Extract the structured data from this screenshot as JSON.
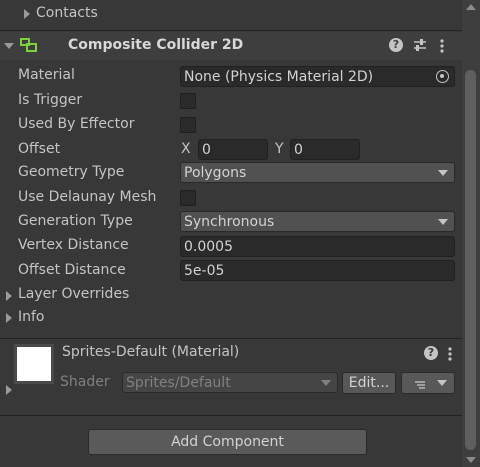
{
  "contacts": {
    "label": "Contacts"
  },
  "component": {
    "title": "Composite Collider 2D",
    "material": {
      "label": "Material",
      "value": "None (Physics Material 2D)"
    },
    "is_trigger": {
      "label": "Is Trigger"
    },
    "used_by_effector": {
      "label": "Used By Effector"
    },
    "offset": {
      "label": "Offset",
      "x_label": "X",
      "x_value": "0",
      "y_label": "Y",
      "y_value": "0"
    },
    "geometry_type": {
      "label": "Geometry Type",
      "value": "Polygons"
    },
    "use_delaunay_mesh": {
      "label": "Use Delaunay Mesh"
    },
    "generation_type": {
      "label": "Generation Type",
      "value": "Synchronous"
    },
    "vertex_distance": {
      "label": "Vertex Distance",
      "value": "0.0005"
    },
    "offset_distance": {
      "label": "Offset Distance",
      "value": "5e-05"
    },
    "layer_overrides": {
      "label": "Layer Overrides"
    },
    "info": {
      "label": "Info"
    }
  },
  "material_section": {
    "title": "Sprites-Default (Material)",
    "shader_label": "Shader",
    "shader_value": "Sprites/Default",
    "edit_label": "Edit..."
  },
  "add_component": {
    "label": "Add Component"
  },
  "colors": {
    "background": "#383838",
    "field": "#2a2a2a",
    "dropdown": "#515151",
    "accent_icon": "#7fd13b"
  }
}
